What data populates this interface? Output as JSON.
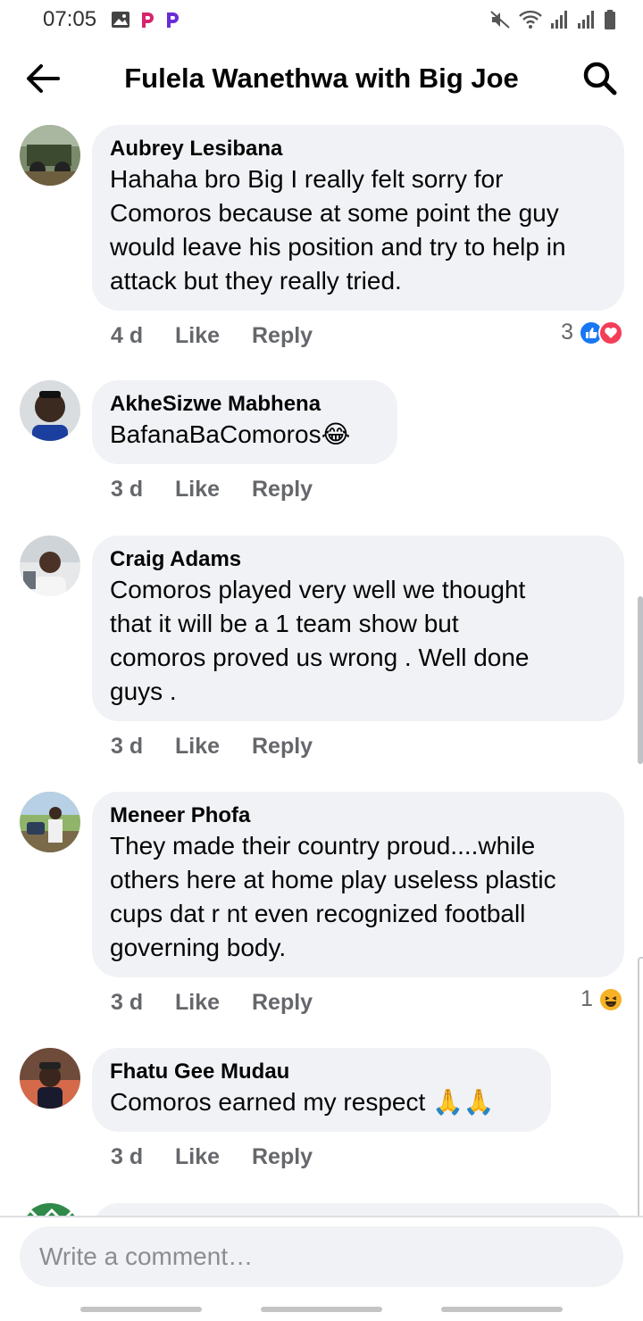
{
  "status_bar": {
    "time": "07:05",
    "left_icons": [
      "image-icon",
      "p-app-icon",
      "p-app-icon"
    ],
    "right_icons": [
      "mute-icon",
      "wifi-icon",
      "signal-icon",
      "signal-icon",
      "battery-icon"
    ]
  },
  "header": {
    "title": "Fulela Wanethwa with Big Joe",
    "back_icon": "back-arrow-icon",
    "search_icon": "search-icon"
  },
  "comments": [
    {
      "author": "Aubrey Lesibana",
      "lines": [
        "Hahaha bro Big I really felt sorry for",
        "Comoros because at some point the guy",
        "would leave his position and try to help in",
        "attack but they really tried."
      ],
      "time": "4 d",
      "like_label": "Like",
      "reply_label": "Reply",
      "reaction_count": "3",
      "reactions": [
        "like-reaction-icon",
        "love-reaction-icon"
      ]
    },
    {
      "author": "AkheSizwe Mabhena",
      "lines": [
        "BafanaBaComoros😂"
      ],
      "time": "3 d",
      "like_label": "Like",
      "reply_label": "Reply"
    },
    {
      "author": "Craig Adams",
      "lines": [
        "Comoros played very well we thought",
        "that it will be a 1 team show but",
        "comoros proved us wrong . Well done",
        "guys ."
      ],
      "time": "3 d",
      "like_label": "Like",
      "reply_label": "Reply"
    },
    {
      "author": "Meneer Phofa",
      "lines": [
        "They made their country proud....while",
        "others here at home play useless plastic",
        "cups dat r nt even recognized football",
        "governing body."
      ],
      "time": "3 d",
      "like_label": "Like",
      "reply_label": "Reply",
      "reaction_count": "1",
      "reactions": [
        "haha-reaction-icon"
      ]
    },
    {
      "author": "Fhatu Gee Mudau",
      "lines": [
        "Comoros earned my respect 🙏🙏"
      ],
      "time": "3 d",
      "like_label": "Like",
      "reply_label": "Reply"
    }
  ],
  "composer": {
    "placeholder": "Write a comment…"
  },
  "colors": {
    "bubble": "#f0f2f5",
    "meta_text": "#65676b",
    "like_blue": "#1877f2",
    "love_red": "#f33e58",
    "haha_yellow": "#f7b125"
  }
}
